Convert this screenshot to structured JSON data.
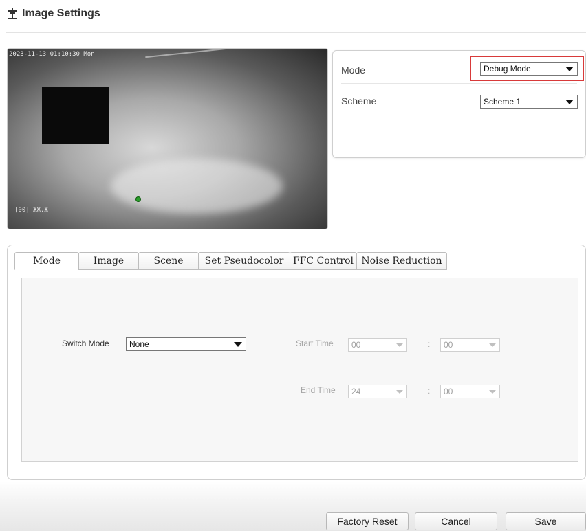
{
  "header": {
    "title": "Image Settings",
    "icon": "image-settings-icon"
  },
  "preview": {
    "timestamp": "2023-11-13 01:10:30 Mon",
    "camera_label": "[00] ЖЖ.Ж"
  },
  "mode_panel": {
    "mode_label": "Mode",
    "mode_value": "Debug Mode",
    "scheme_label": "Scheme",
    "scheme_value": "Scheme 1",
    "highlight_color": "#d83a3a"
  },
  "tabs": [
    {
      "label": "Mode",
      "active": true
    },
    {
      "label": "Image",
      "active": false
    },
    {
      "label": "Scene",
      "active": false
    },
    {
      "label": "Set Pseudocolor",
      "active": false
    },
    {
      "label": "FFC Control",
      "active": false
    },
    {
      "label": "Noise Reduction",
      "active": false
    }
  ],
  "mode_tab": {
    "switch_mode_label": "Switch Mode",
    "switch_mode_value": "None",
    "start_time_label": "Start Time",
    "start_hour": "00",
    "start_minute": "00",
    "end_time_label": "End Time",
    "end_hour": "24",
    "end_minute": "00",
    "colon": ":"
  },
  "buttons": {
    "factory_reset": "Factory Reset",
    "cancel": "Cancel",
    "save": "Save"
  }
}
